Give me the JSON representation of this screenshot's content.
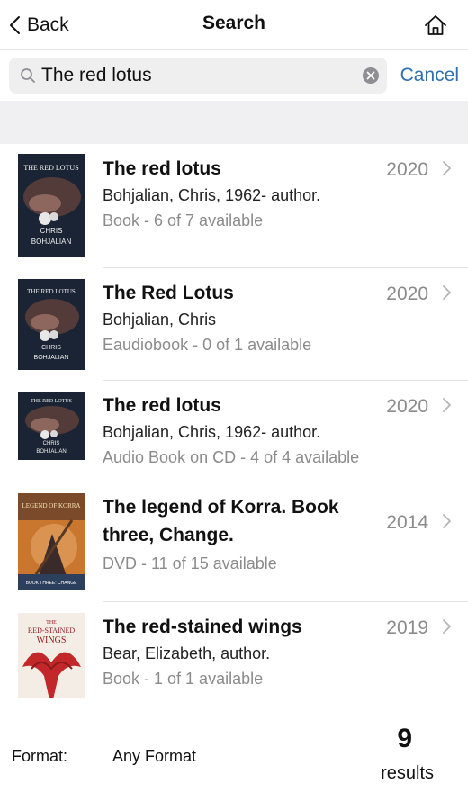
{
  "nav": {
    "back_label": "Back",
    "title": "Search",
    "home_icon": "home-icon"
  },
  "search": {
    "value": "The red lotus",
    "cancel_label": "Cancel"
  },
  "results": [
    {
      "title": "The red lotus",
      "author": "Bohjalian, Chris, 1962- author.",
      "format": "Book - 6 of 7 available",
      "year": "2020",
      "cover_text": [
        "THE RED LOTUS",
        "CHRIS",
        "BOHJALIAN"
      ]
    },
    {
      "title": "The Red Lotus",
      "author": "Bohjalian, Chris",
      "format": "Eaudiobook - 0 of 1 available",
      "year": "2020",
      "cover_text": [
        "THE RED LOTUS",
        "CHRIS",
        "BOHJALIAN"
      ]
    },
    {
      "title": "The red lotus",
      "author": "Bohjalian, Chris, 1962- author.",
      "format": "Audio Book on CD - 4 of 4 available",
      "year": "2020",
      "cover_text": [
        "THE RED LOTUS",
        "CHRIS",
        "BOHJALIAN"
      ]
    },
    {
      "title_line1": "The legend of Korra. Book",
      "title_line2": "three, Change.",
      "format": "DVD - 11 of 15 available",
      "year": "2014",
      "cover_text": [
        "LEGEND OF KORRA",
        "BOOK THREE: CHANGE"
      ]
    },
    {
      "title": "The red-stained wings",
      "author": "Bear, Elizabeth, author.",
      "format": "Book - 1 of 1 available",
      "year": "2019",
      "cover_text": [
        "THE",
        "RED-STAINED",
        "WINGS"
      ]
    }
  ],
  "footer": {
    "format_label": "Format:",
    "format_value": "Any Format",
    "count": "9",
    "count_label": "results"
  },
  "colors": {
    "accent": "#2f6fb1",
    "muted_text": "#8b8b8b",
    "band": "#f0f0f2"
  }
}
